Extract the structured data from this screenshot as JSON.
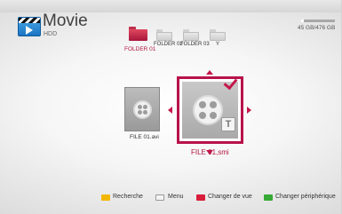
{
  "header": {
    "title": "Movie",
    "source": "HDD"
  },
  "storage": {
    "text": "45 GB/476 GB",
    "used_fraction": 0.09
  },
  "folders": [
    {
      "label": "FOLDER 01",
      "selected": true
    },
    {
      "label": "FOLDER 02",
      "selected": false
    },
    {
      "label": "FOLDER 03",
      "selected": false
    },
    {
      "label": "Y",
      "selected": false
    }
  ],
  "files": [
    {
      "label": "FILE 01.avi",
      "icon": "film-reel-icon",
      "selected": false
    },
    {
      "label": "FILE 01,smi",
      "icon": "film-reel-subtitle-icon",
      "badge": "T",
      "checked": true,
      "selected": true
    }
  ],
  "help_bar": [
    {
      "key_color": "#f2b705",
      "label": "Recherche"
    },
    {
      "key_color": "#f4f4f4",
      "label": "Menu"
    },
    {
      "key_color": "#d81e3a",
      "label": "Changer de vue"
    },
    {
      "key_color": "#37a936",
      "label": "Changer périphérique"
    }
  ],
  "colors": {
    "accent": "#b8124a"
  }
}
